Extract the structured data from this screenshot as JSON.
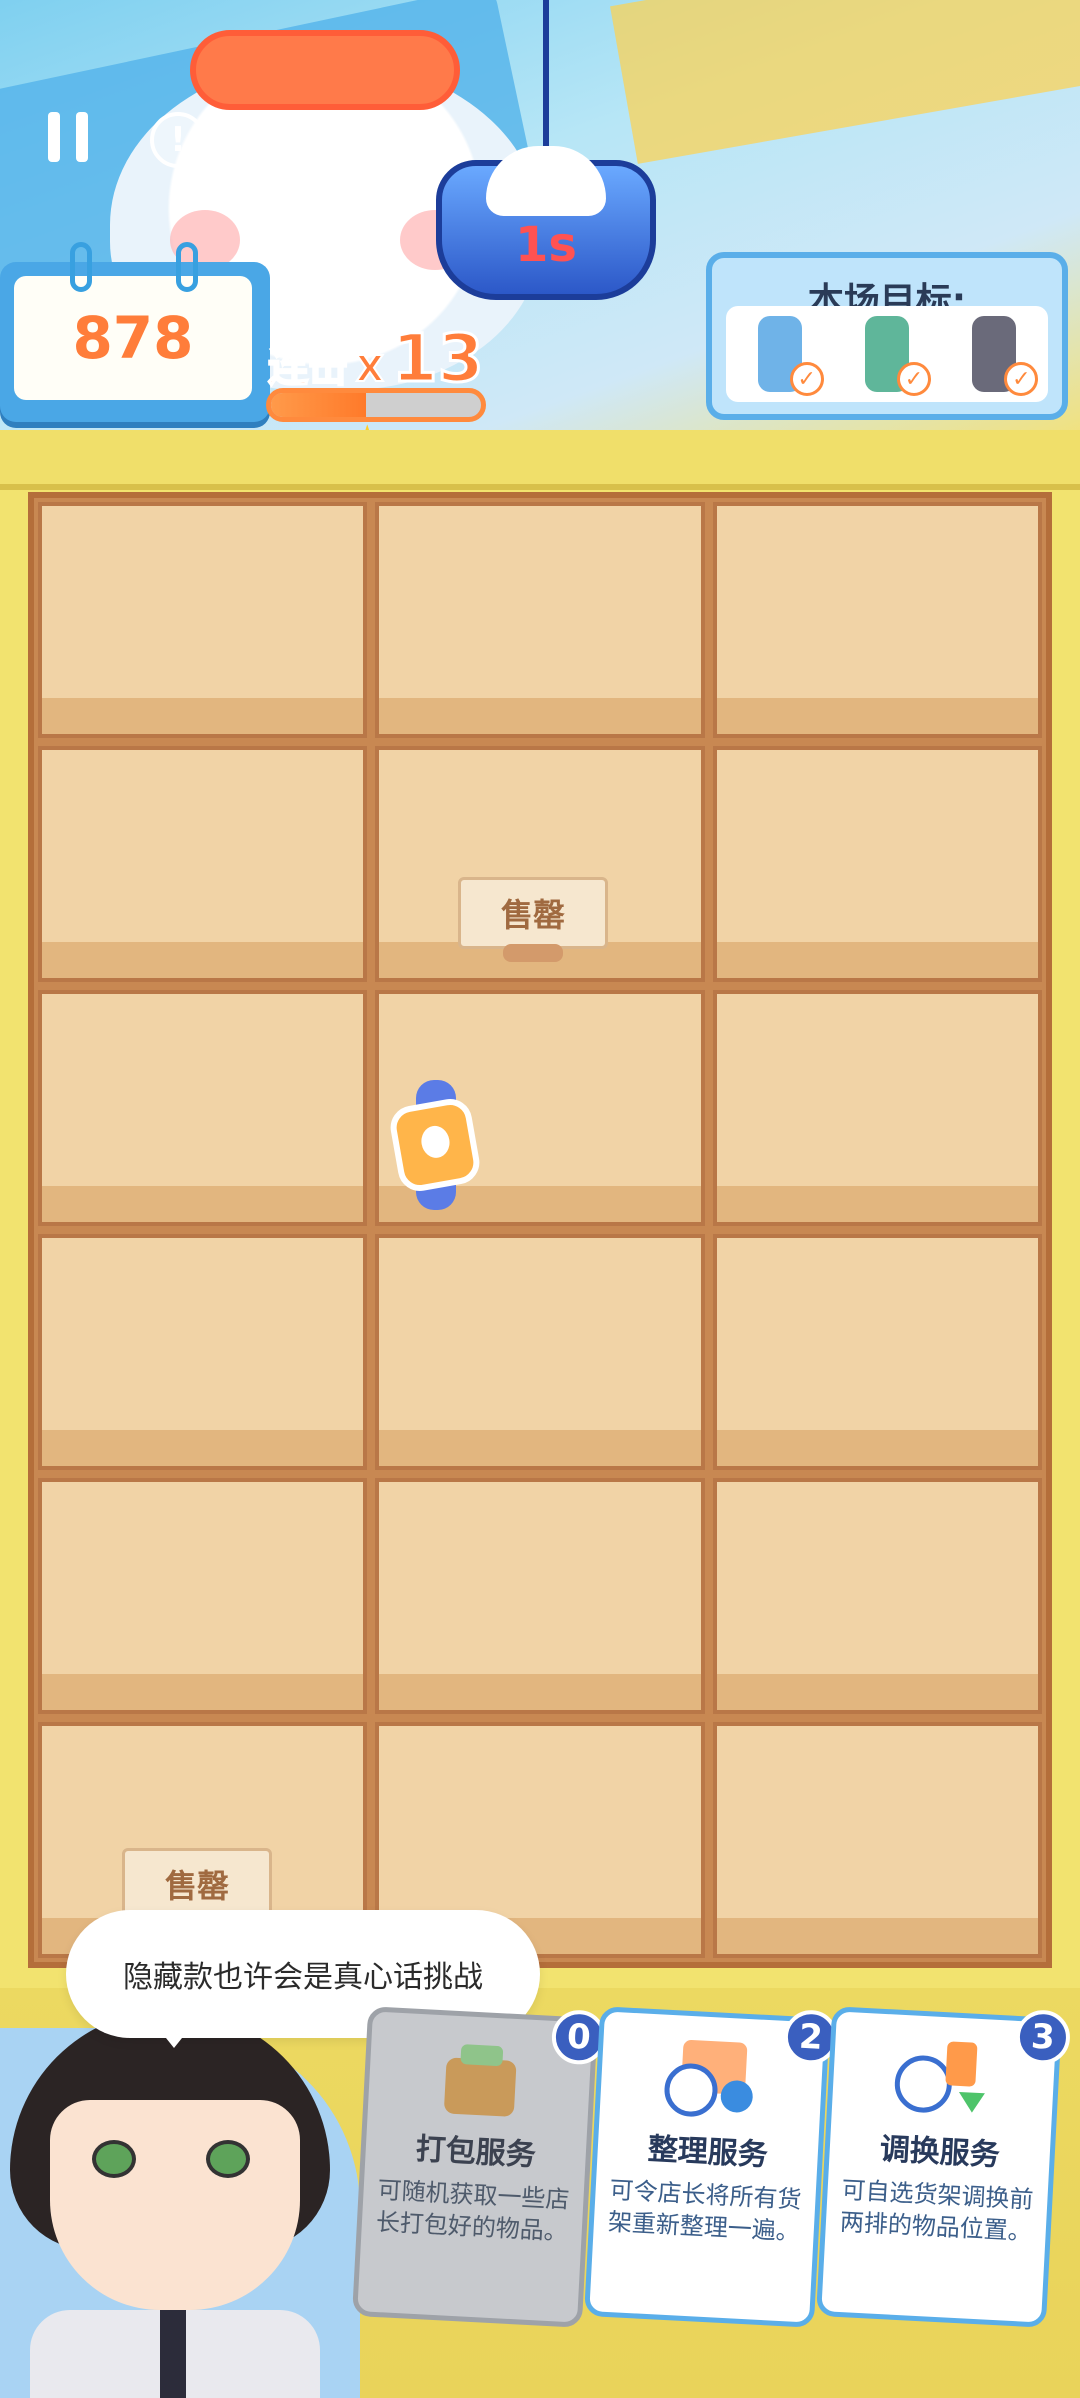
{
  "hud": {
    "score": "878",
    "combo_label": "连击",
    "combo_x": "X",
    "combo_count": "13",
    "combo_progress": 0.45,
    "timer": "1s"
  },
  "targets": {
    "title": "本场目标:",
    "items": [
      {
        "name": "phone-case",
        "done": true,
        "color": "#6fb3e8"
      },
      {
        "name": "glove",
        "done": true,
        "color": "#5fb69a"
      },
      {
        "name": "plush-bag",
        "done": true,
        "color": "#6a6a7a"
      }
    ]
  },
  "board": {
    "rows": 6,
    "cols": 3,
    "sold_label": "售罄"
  },
  "speech": {
    "text": "隐藏款也许会是真心话挑战"
  },
  "services": [
    {
      "name": "打包服务",
      "desc": "可随机获取一些店长打包好的物品。",
      "count": "0",
      "enabled": false
    },
    {
      "name": "整理服务",
      "desc": "可令店长将所有货架重新整理一遍。",
      "count": "2",
      "enabled": true
    },
    {
      "name": "调换服务",
      "desc": "可自选货架调换前两排的物品位置。",
      "count": "3",
      "enabled": true
    }
  ]
}
